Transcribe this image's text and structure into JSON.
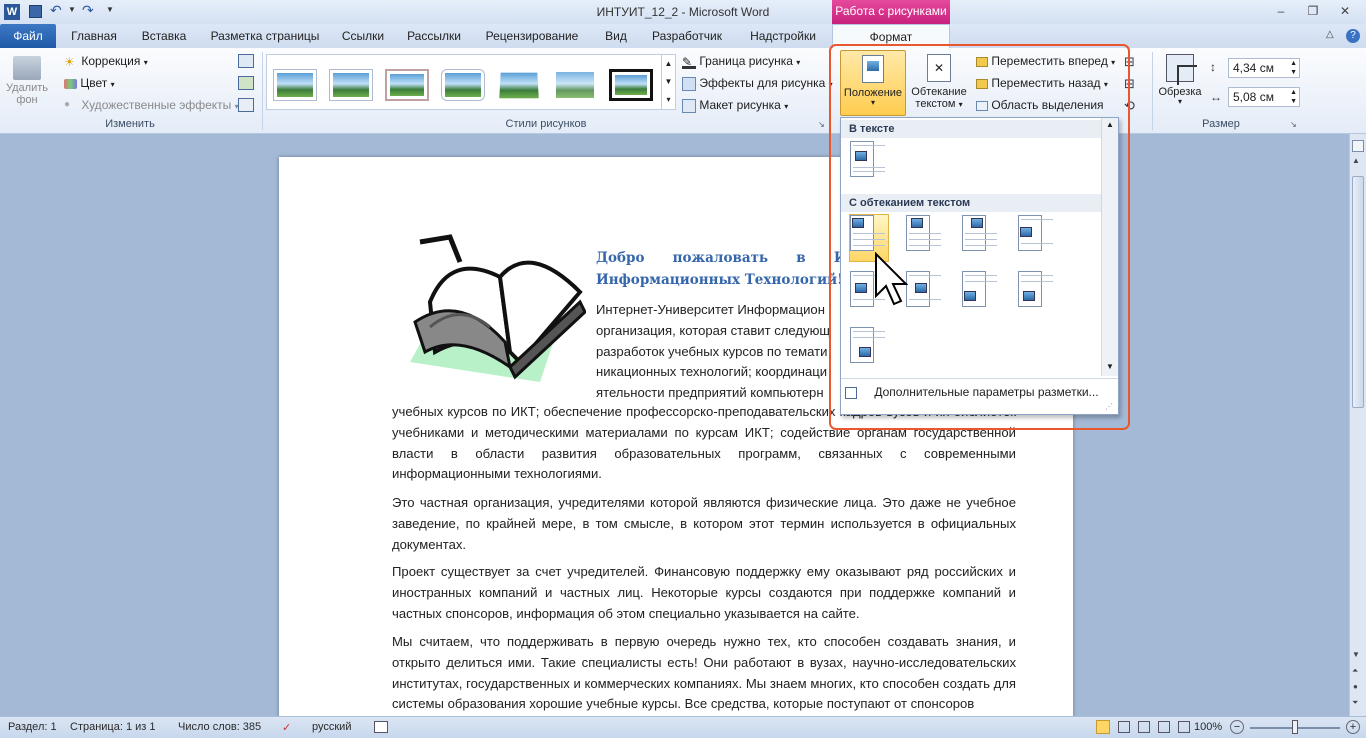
{
  "titlebar": {
    "title": "ИНТУИТ_12_2  -  Microsoft Word",
    "minimize": "–",
    "restore": "❐",
    "close": "✕"
  },
  "tabs": {
    "file": "Файл",
    "home": "Главная",
    "insert": "Вставка",
    "layout": "Разметка страницы",
    "links": "Ссылки",
    "mailings": "Рассылки",
    "review": "Рецензирование",
    "view": "Вид",
    "developer": "Разработчик",
    "addins": "Надстройки",
    "context_group": "Работа с рисунками",
    "format": "Формат"
  },
  "ribbon": {
    "remove_bg": "Удалить фон",
    "correction": "Коррекция",
    "color": "Цвет",
    "art_effects": "Художественные эффекты",
    "group_change": "Изменить",
    "group_styles": "Стили рисунков",
    "border": "Граница рисунка",
    "effects": "Эффекты для рисунка",
    "layout": "Макет рисунка",
    "position": "Положение",
    "wrap1": "Обтекание",
    "wrap2": "текстом",
    "forward": "Переместить вперед",
    "backward": "Переместить назад",
    "selection": "Область выделения",
    "crop": "Обрезка",
    "height": "4,34 см",
    "width": "5,08 см",
    "group_size": "Размер"
  },
  "dropdown": {
    "in_text": "В тексте",
    "with_wrap": "С обтеканием текстом",
    "more": "Дополнительные параметры разметки..."
  },
  "document": {
    "heading1": "Добро      пожаловать      в      И",
    "heading2": "Информационных Технологий!",
    "p1_lines": [
      "Интернет-Университет Информацион",
      "организация, которая ставит следующ",
      "разработок учебных курсов по темати",
      "никационных технологий; координаци",
      "ятельности предприятий компьютерн"
    ],
    "p1_rest": "учебных курсов по ИКТ; обеспечение профессорско-преподавательских кадров вузов и их библиотек учебниками и методическими материалами по курсам ИКТ; содействие органам государственной власти в области развития образовательных программ, связанных с современными информационными технологиями.",
    "p2": "Это частная организация, учредителями которой являются физические лица. Это даже не учебное заведение, по крайней мере, в том смысле, в котором этот термин используется в официальных документах.",
    "p3": "Проект существует за счет учредителей. Финансовую поддержку ему оказывают ряд российских и иностранных компаний и частных лиц. Некоторые курсы создаются при поддержке компаний и частных спонсоров, информация об этом специально указывается на сайте.",
    "p4": "Мы считаем, что поддерживать в первую очередь нужно тех, кто способен создавать знания, и открыто делиться ими. Такие специалисты есть! Они работают в вузах, научно-исследовательских институтах, государственных и коммерческих компаниях. Мы знаем многих, кто способен создать для системы образования хорошие учебные курсы. Все средства, которые поступают от спонсоров"
  },
  "status": {
    "section": "Раздел: 1",
    "page": "Страница: 1 из 1",
    "words": "Число слов: 385",
    "lang": "русский",
    "zoom": "100%"
  }
}
